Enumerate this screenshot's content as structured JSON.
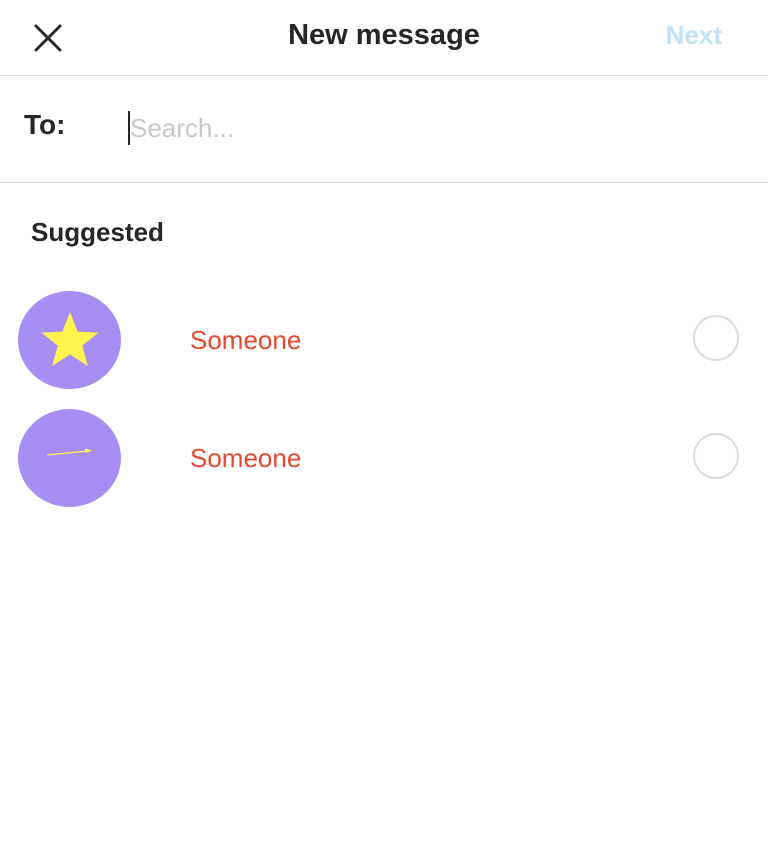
{
  "header": {
    "title": "New message",
    "next_label": "Next",
    "next_color": "#c3e0fb",
    "close_icon": "close-icon"
  },
  "recipient": {
    "to_label": "To:",
    "search_placeholder": "Search...",
    "search_value": ""
  },
  "suggested": {
    "title": "Suggested",
    "items": [
      {
        "name": "Someone",
        "avatar_icon": "star-icon",
        "selected": false
      },
      {
        "name": "Someone",
        "avatar_icon": "arrow-icon",
        "selected": false
      }
    ]
  },
  "colors": {
    "avatar_bg": "#a78ef5",
    "avatar_glyph": "#fff44f",
    "name_text": "#e8472d",
    "divider": "#dbdbdb"
  }
}
